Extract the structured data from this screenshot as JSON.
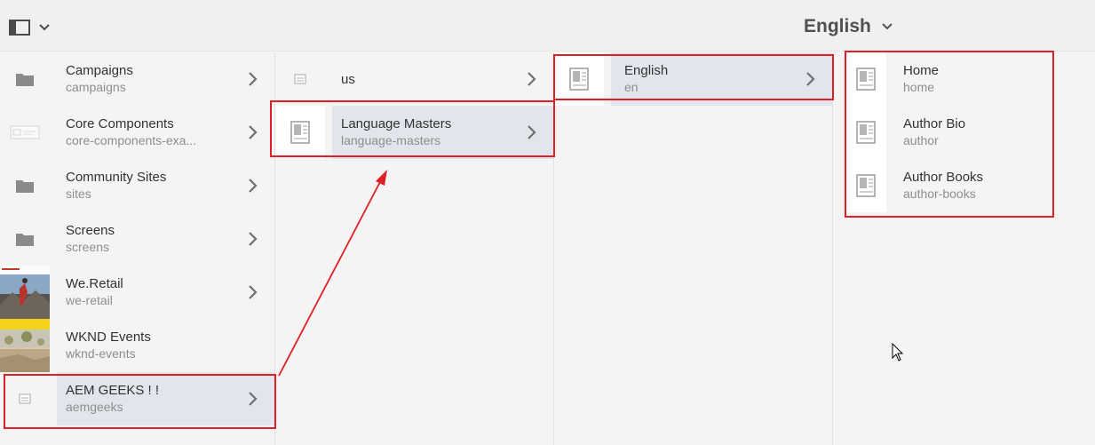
{
  "header": {
    "language_label": "English",
    "rail_icon": "panel-toggle-icon",
    "dropdown_icon": "chevron-down-icon"
  },
  "columns": {
    "sites": [
      {
        "title": "Campaigns",
        "name": "campaigns",
        "icon": "folder-icon"
      },
      {
        "title": "Core Components",
        "name": "core-components-exa...",
        "icon": "template-thumbnail"
      },
      {
        "title": "Community Sites",
        "name": "sites",
        "icon": "folder-icon"
      },
      {
        "title": "Screens",
        "name": "screens",
        "icon": "folder-icon"
      },
      {
        "title": "We.Retail",
        "name": "we-retail",
        "icon": "we-retail-thumbnail"
      },
      {
        "title": "WKND Events",
        "name": "wknd-events",
        "icon": "wknd-thumbnail"
      },
      {
        "title": "AEM GEEKS ! !",
        "name": "aemgeeks",
        "icon": "page-icon"
      }
    ],
    "aemgeeks": [
      {
        "title": "us",
        "name": "",
        "icon": "page-icon"
      },
      {
        "title": "Language Masters",
        "name": "language-masters",
        "icon": "page-template-icon"
      }
    ],
    "language_masters": [
      {
        "title": "English",
        "name": "en",
        "icon": "page-template-icon"
      }
    ],
    "english": [
      {
        "title": "Home",
        "name": "home",
        "icon": "page-template-icon"
      },
      {
        "title": "Author Bio",
        "name": "author",
        "icon": "page-template-icon"
      },
      {
        "title": "Author Books",
        "name": "author-books",
        "icon": "page-template-icon"
      }
    ]
  },
  "colors": {
    "highlight_box": "#e01e25",
    "selected_row": "#e2e5ec"
  }
}
